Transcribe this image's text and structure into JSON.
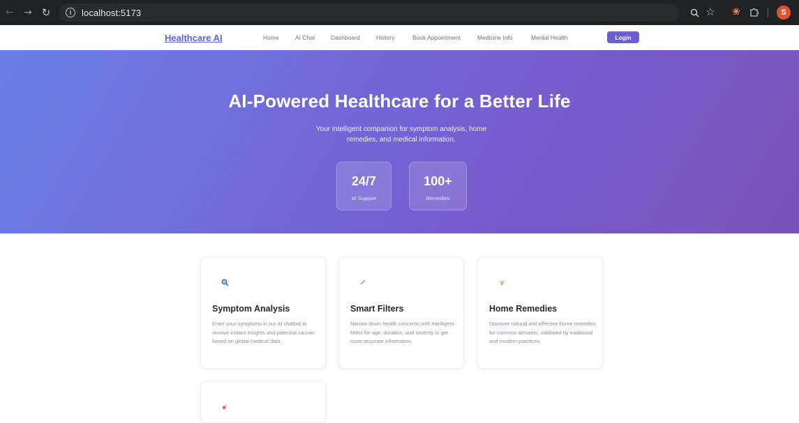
{
  "browser": {
    "back_icon": "←",
    "forward_icon": "→",
    "reload_icon": "↻",
    "info_icon": "i",
    "url": "localhost:5173",
    "zoom_icon": "🔍",
    "star_icon": "☆",
    "extension_icon": "❀",
    "puzzle_icon": "⬚",
    "profile_initial": "S",
    "profile_color": "#e0532e"
  },
  "nav": {
    "brand": "Healthcare AI",
    "links": [
      "Home",
      "AI Chat",
      "Dashboard",
      "History",
      "Book Appointment",
      "Medicine Info",
      "Mental Health"
    ],
    "login_label": "Login",
    "brand_color": "#5b63d3",
    "login_color": "#6b5fd3"
  },
  "hero": {
    "title": "AI-Powered Healthcare for a Better Life",
    "subtitle": "Your intelligent companion for symptom analysis, home remedies, and medical information.",
    "stats": [
      {
        "value": "24/7",
        "label": "AI Support"
      },
      {
        "value": "100+",
        "label": "Remedies"
      }
    ]
  },
  "features": [
    {
      "icon": "search-icon",
      "glyph": "🔍",
      "title": "Symptom Analysis",
      "description": "Enter your symptoms in our AI chatbot to receive instant insights and potential causes based on global medical data."
    },
    {
      "icon": "filter-icon",
      "glyph": "✎",
      "title": "Smart Filters",
      "description": "Narrow down health concerns with intelligent filters for age, duration, and severity to get more accurate information."
    },
    {
      "icon": "herb-icon",
      "glyph": "❦",
      "title": "Home Remedies",
      "description": "Discover natural and effective home remedies for common ailments, validated by traditional and modern practices."
    },
    {
      "icon": "pill-icon",
      "glyph": "💊",
      "title": "",
      "description": ""
    }
  ]
}
